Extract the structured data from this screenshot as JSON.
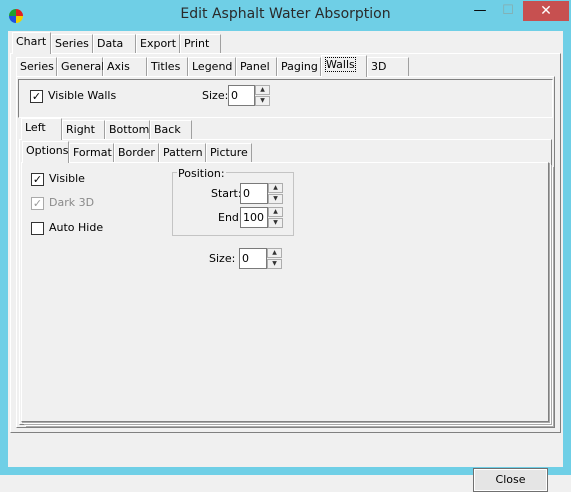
{
  "window": {
    "title": "Edit Asphalt Water Absorption",
    "minimize_glyph": "—",
    "maximize_glyph": "☐",
    "close_glyph": "✕",
    "icon": "app-chart-icon"
  },
  "main_tabs": [
    "Chart",
    "Series",
    "Data",
    "Export",
    "Print"
  ],
  "chart_tabs": [
    "Series",
    "General",
    "Axis",
    "Titles",
    "Legend",
    "Panel",
    "Paging",
    "Walls",
    "3D"
  ],
  "walls": {
    "visible_label": "Visible Walls",
    "visible_checked": "✓",
    "size_label": "Size:",
    "size_value": "0"
  },
  "wall_tabs": [
    "Left",
    "Right",
    "Bottom",
    "Back"
  ],
  "option_tabs": [
    "Options",
    "Format",
    "Border",
    "Pattern",
    "Picture"
  ],
  "options": {
    "visible_label": "Visible",
    "visible_checked": "✓",
    "dark3d_label": "Dark 3D",
    "dark3d_checked": "✓",
    "autohide_label": "Auto Hide",
    "position_group": "Position:",
    "start_label": "Start:",
    "start_value": "0",
    "end_label": "End:",
    "end_value": "100",
    "size_label": "Size:",
    "size_value": "0"
  },
  "spin": {
    "up": "▲",
    "down": "▼"
  },
  "buttons": {
    "close": "Close"
  }
}
